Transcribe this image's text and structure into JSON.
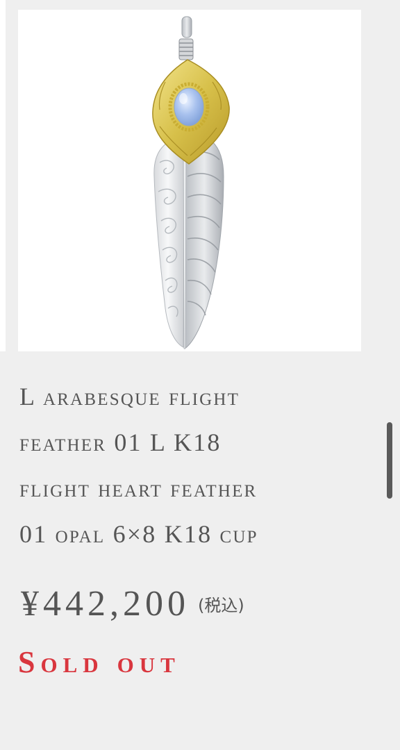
{
  "product": {
    "title_lines": [
      "L arabesque flight",
      "feather 01 L K18",
      "flight heart feather",
      "01 opal 6×8 K18 cup"
    ],
    "price": "¥442,200",
    "tax_note": "(税込)",
    "status": "Sold out",
    "image_subject": "feather-pendant",
    "colors": {
      "status": "#d9363e",
      "text": "#555555",
      "background": "#efefef"
    }
  }
}
